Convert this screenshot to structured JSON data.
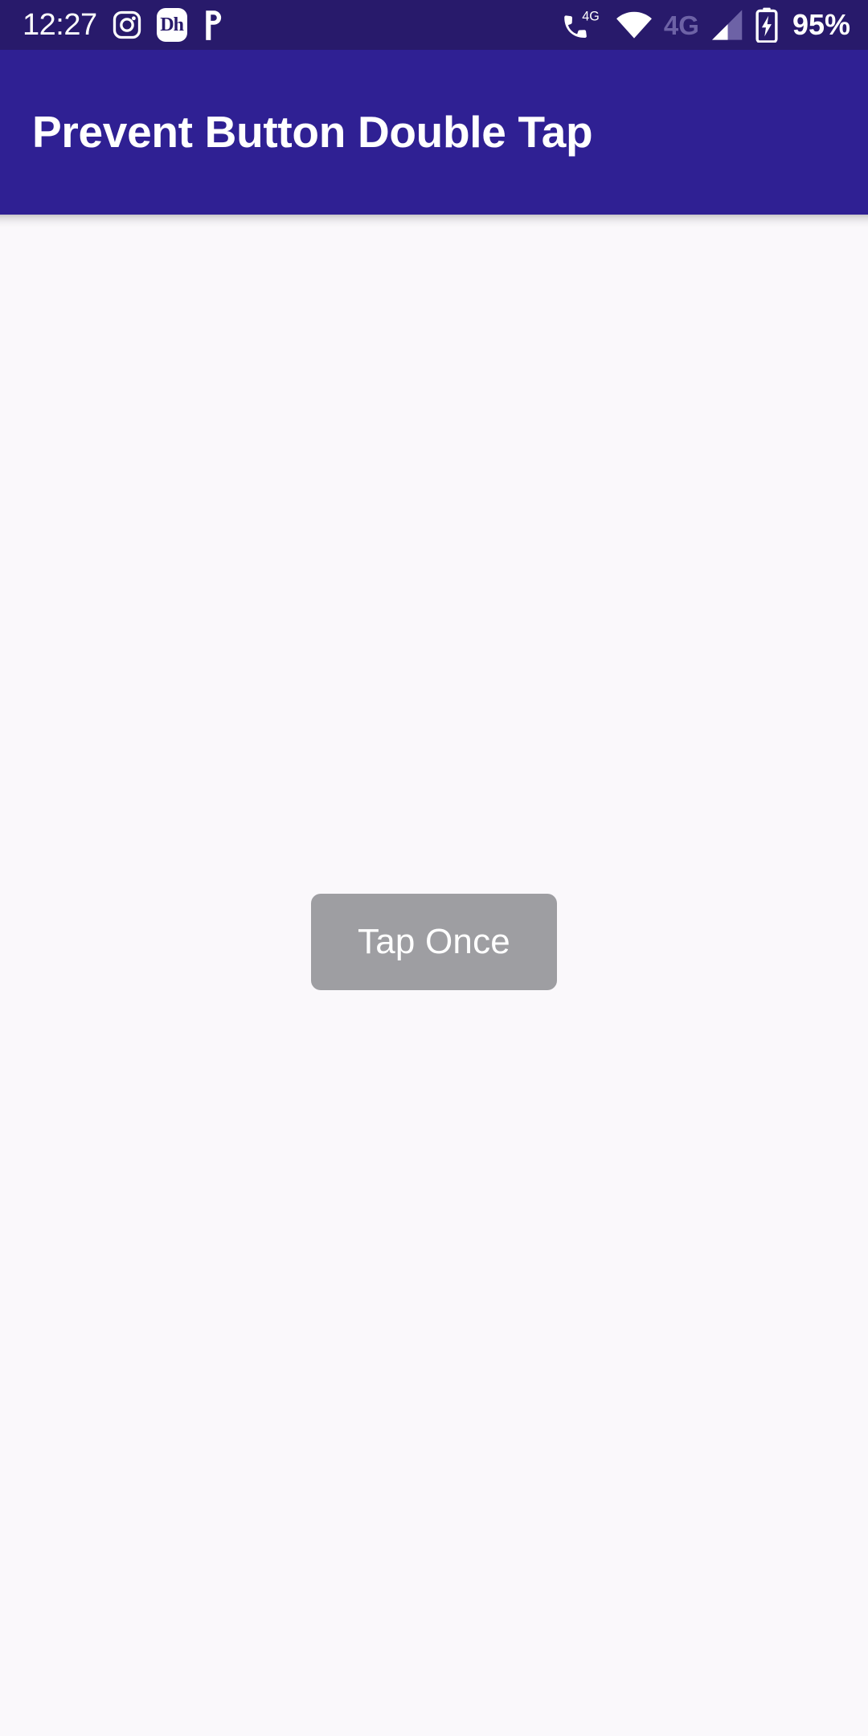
{
  "status_bar": {
    "clock": "12:27",
    "battery_percent": "95%",
    "network_label": "4G",
    "volte_label": "4G",
    "background_color": "#281a6b",
    "text_color": "#ffffff",
    "dimmed_color": "#6d62a6",
    "notification_icons": [
      {
        "name": "instagram-icon",
        "label": ""
      },
      {
        "name": "disney-hotstar-icon",
        "label": "Dh"
      },
      {
        "name": "phonepe-icon",
        "label": ""
      }
    ],
    "system_icons": [
      {
        "name": "volte-phone-4g-icon"
      },
      {
        "name": "wifi-icon"
      },
      {
        "name": "mobile-signal-icon"
      },
      {
        "name": "battery-charging-icon"
      }
    ]
  },
  "app_bar": {
    "title": "Prevent Button Double Tap",
    "background_color": "#2f2093",
    "title_color": "#ffffff"
  },
  "main": {
    "background_color": "#faf8fb",
    "button": {
      "label": "Tap Once",
      "background_color": "#9e9ea2",
      "text_color": "#ffffff",
      "state": "disabled"
    }
  }
}
